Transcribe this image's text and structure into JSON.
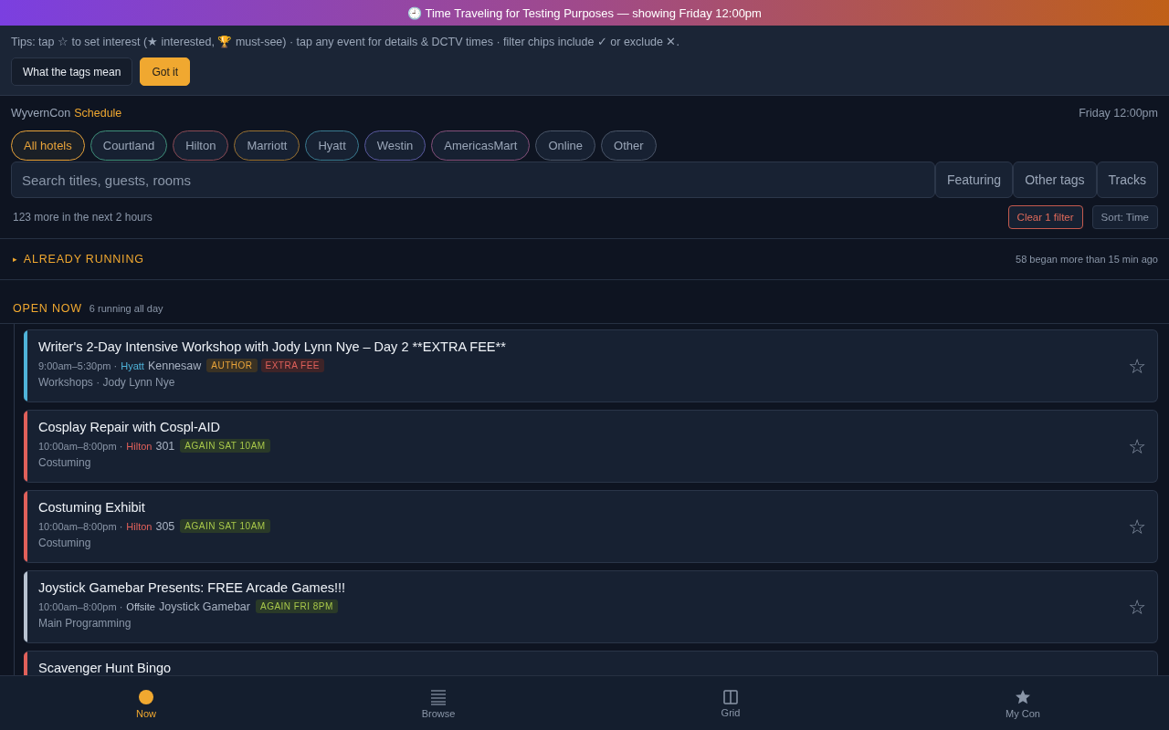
{
  "banner": {
    "text": "🕘 Time Traveling for Testing Purposes — showing Friday 12:00pm"
  },
  "tips": {
    "text": "Tips: tap ☆ to set interest (★ interested, 🏆 must-see) · tap any event for details & DCTV times · filter chips include ✓ or exclude ✕.",
    "buttons": [
      {
        "label": "What the tags mean",
        "kind": "secondary"
      },
      {
        "label": "Got it",
        "kind": "primary"
      }
    ]
  },
  "header": {
    "brand": "WyvernCon",
    "title": "Schedule",
    "now": "Friday 12:00pm"
  },
  "hotel_chips": [
    {
      "label": "All hotels",
      "selected": true,
      "color": "#e8a33a"
    },
    {
      "label": "Courtland",
      "selected": false,
      "color": "#3f8f7a"
    },
    {
      "label": "Hilton",
      "selected": false,
      "color": "#8a4a55"
    },
    {
      "label": "Marriott",
      "selected": false,
      "color": "#9a7232"
    },
    {
      "label": "Hyatt",
      "selected": false,
      "color": "#3a7a90"
    },
    {
      "label": "Westin",
      "selected": false,
      "color": "#5a5aa0"
    },
    {
      "label": "AmericasMart",
      "selected": false,
      "color": "#84507a"
    },
    {
      "label": "Online",
      "selected": false,
      "color": "#4a5568"
    },
    {
      "label": "Other",
      "selected": false,
      "color": "#4a5568"
    }
  ],
  "search": {
    "placeholder": "Search titles, guests, rooms"
  },
  "filter_buttons": [
    "Featuring",
    "Other tags",
    "Tracks"
  ],
  "summary": {
    "text": "123 more in the next 2 hours",
    "clear": "Clear 1 filter",
    "sort": "Sort: Time"
  },
  "already_running": {
    "marker": "▸",
    "label": "ALREADY RUNNING",
    "expanded": false,
    "note": "58 began more than 15 min ago"
  },
  "open_now": {
    "label": "OPEN NOW",
    "note": "6 running all day"
  },
  "events": [
    {
      "title": "Writer's 2-Day Intensive Workshop with Jody Lynn Nye – Day 2 **EXTRA FEE**",
      "time": "9:00am–5:30pm ·",
      "venue": "Hyatt",
      "color": "#4fb3d9",
      "room": "Kennesaw",
      "tags": [
        {
          "text": "AUTHOR",
          "kind": "author"
        },
        {
          "text": "EXTRA FEE",
          "kind": "fee"
        }
      ],
      "detail": "Workshops · Jody Lynn Nye",
      "star": "☆"
    },
    {
      "title": "Cosplay Repair with Cospl-AID",
      "time": "10:00am–8:00pm ·",
      "venue": "Hilton",
      "color": "#e0605a",
      "room": "301",
      "tags": [
        {
          "text": "AGAIN SAT 10AM",
          "kind": "again"
        }
      ],
      "detail": "Costuming",
      "star": "☆"
    },
    {
      "title": "Costuming Exhibit",
      "time": "10:00am–8:00pm ·",
      "venue": "Hilton",
      "color": "#e0605a",
      "room": "305",
      "tags": [
        {
          "text": "AGAIN SAT 10AM",
          "kind": "again"
        }
      ],
      "detail": "Costuming",
      "star": "☆"
    },
    {
      "title": "Joystick Gamebar Presents: FREE Arcade Games!!!",
      "time": "10:00am–8:00pm ·",
      "venue": "Offsite",
      "color": "#b8c2d0",
      "room": "Joystick Gamebar",
      "tags": [
        {
          "text": "AGAIN FRI 8PM",
          "kind": "again"
        }
      ],
      "detail": "Main Programming",
      "star": "☆"
    },
    {
      "title": "Scavenger Hunt Bingo",
      "color": "#e0605a"
    }
  ],
  "nav": [
    {
      "label": "Now",
      "selected": true
    },
    {
      "label": "Browse",
      "selected": false
    },
    {
      "label": "Grid",
      "selected": false
    },
    {
      "label": "My Con",
      "selected": false
    }
  ]
}
